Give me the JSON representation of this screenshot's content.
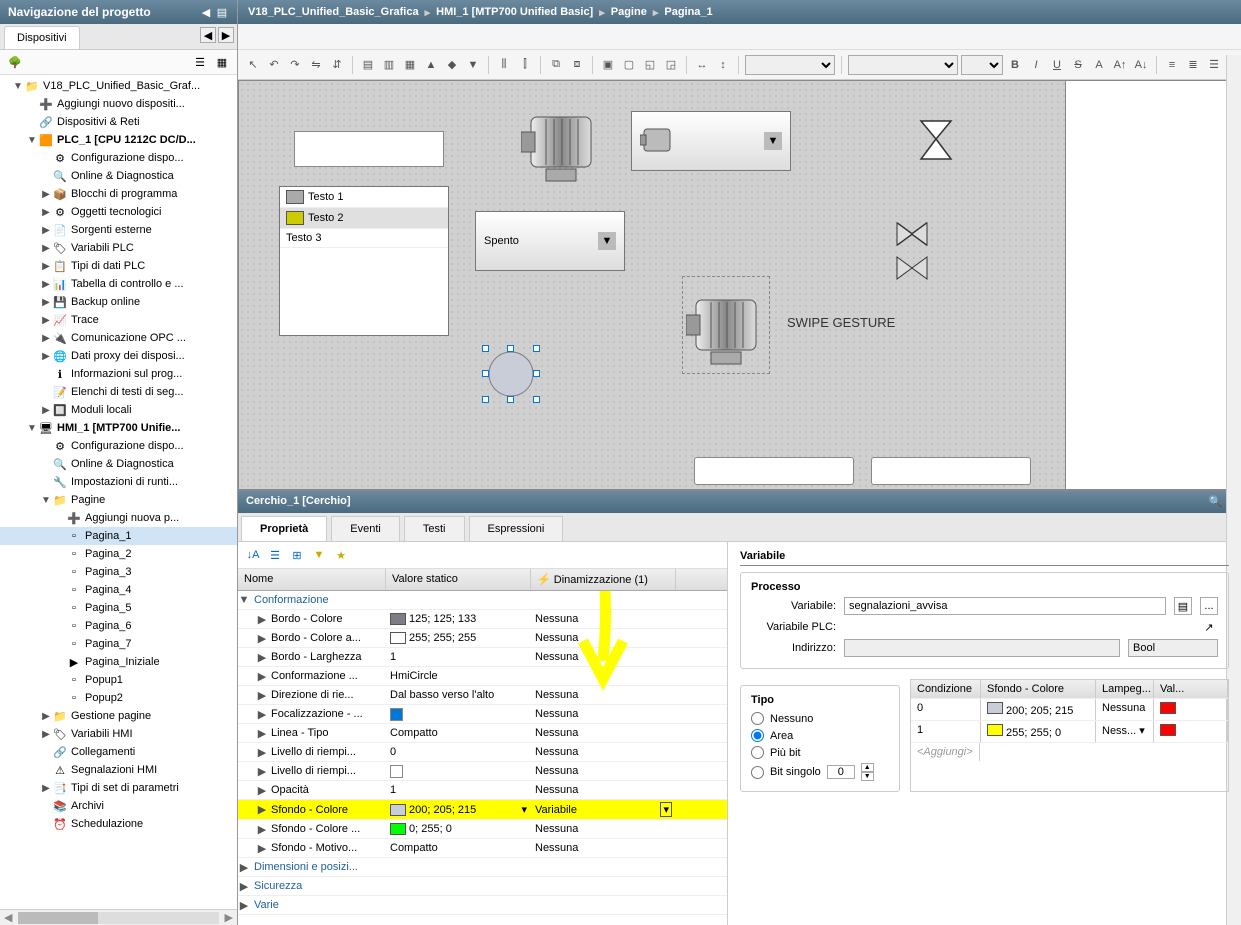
{
  "left": {
    "title": "Navigazione del progetto",
    "tab": "Dispositivi",
    "tree": [
      {
        "lvl": 0,
        "toggle": "▼",
        "icon": "📁",
        "label": "V18_PLC_Unified_Basic_Graf..."
      },
      {
        "lvl": 1,
        "toggle": "",
        "icon": "➕",
        "label": "Aggiungi nuovo dispositi..."
      },
      {
        "lvl": 1,
        "toggle": "",
        "icon": "🔗",
        "label": "Dispositivi & Reti"
      },
      {
        "lvl": 1,
        "toggle": "▼",
        "icon": "🟧",
        "label": "PLC_1 [CPU 1212C DC/D...",
        "bold": true
      },
      {
        "lvl": 2,
        "toggle": "",
        "icon": "⚙",
        "label": "Configurazione dispo..."
      },
      {
        "lvl": 2,
        "toggle": "",
        "icon": "🔍",
        "label": "Online & Diagnostica"
      },
      {
        "lvl": 2,
        "toggle": "▶",
        "icon": "📦",
        "label": "Blocchi di programma"
      },
      {
        "lvl": 2,
        "toggle": "▶",
        "icon": "⚙",
        "label": "Oggetti tecnologici"
      },
      {
        "lvl": 2,
        "toggle": "▶",
        "icon": "📄",
        "label": "Sorgenti esterne"
      },
      {
        "lvl": 2,
        "toggle": "▶",
        "icon": "🏷",
        "label": "Variabili PLC"
      },
      {
        "lvl": 2,
        "toggle": "▶",
        "icon": "📋",
        "label": "Tipi di dati PLC"
      },
      {
        "lvl": 2,
        "toggle": "▶",
        "icon": "📊",
        "label": "Tabella di controllo e ..."
      },
      {
        "lvl": 2,
        "toggle": "▶",
        "icon": "💾",
        "label": "Backup online"
      },
      {
        "lvl": 2,
        "toggle": "▶",
        "icon": "📈",
        "label": "Trace"
      },
      {
        "lvl": 2,
        "toggle": "▶",
        "icon": "🔌",
        "label": "Comunicazione OPC ..."
      },
      {
        "lvl": 2,
        "toggle": "▶",
        "icon": "🌐",
        "label": "Dati proxy dei disposi..."
      },
      {
        "lvl": 2,
        "toggle": "",
        "icon": "ℹ",
        "label": "Informazioni sul prog..."
      },
      {
        "lvl": 2,
        "toggle": "",
        "icon": "📝",
        "label": "Elenchi di testi di seg..."
      },
      {
        "lvl": 2,
        "toggle": "▶",
        "icon": "🔲",
        "label": "Moduli locali"
      },
      {
        "lvl": 1,
        "toggle": "▼",
        "icon": "🖥",
        "label": "HMI_1 [MTP700 Unifie...",
        "bold": true
      },
      {
        "lvl": 2,
        "toggle": "",
        "icon": "⚙",
        "label": "Configurazione dispo..."
      },
      {
        "lvl": 2,
        "toggle": "",
        "icon": "🔍",
        "label": "Online & Diagnostica"
      },
      {
        "lvl": 2,
        "toggle": "",
        "icon": "🔧",
        "label": "Impostazioni di runti..."
      },
      {
        "lvl": 2,
        "toggle": "▼",
        "icon": "📁",
        "label": "Pagine"
      },
      {
        "lvl": 3,
        "toggle": "",
        "icon": "➕",
        "label": "Aggiungi nuova p..."
      },
      {
        "lvl": 3,
        "toggle": "",
        "icon": "▫",
        "label": "Pagina_1",
        "selected": true
      },
      {
        "lvl": 3,
        "toggle": "",
        "icon": "▫",
        "label": "Pagina_2"
      },
      {
        "lvl": 3,
        "toggle": "",
        "icon": "▫",
        "label": "Pagina_3"
      },
      {
        "lvl": 3,
        "toggle": "",
        "icon": "▫",
        "label": "Pagina_4"
      },
      {
        "lvl": 3,
        "toggle": "",
        "icon": "▫",
        "label": "Pagina_5"
      },
      {
        "lvl": 3,
        "toggle": "",
        "icon": "▫",
        "label": "Pagina_6"
      },
      {
        "lvl": 3,
        "toggle": "",
        "icon": "▫",
        "label": "Pagina_7"
      },
      {
        "lvl": 3,
        "toggle": "",
        "icon": "▶",
        "label": "Pagina_Iniziale"
      },
      {
        "lvl": 3,
        "toggle": "",
        "icon": "▫",
        "label": "Popup1"
      },
      {
        "lvl": 3,
        "toggle": "",
        "icon": "▫",
        "label": "Popup2"
      },
      {
        "lvl": 2,
        "toggle": "▶",
        "icon": "📁",
        "label": "Gestione pagine"
      },
      {
        "lvl": 2,
        "toggle": "▶",
        "icon": "🏷",
        "label": "Variabili HMI"
      },
      {
        "lvl": 2,
        "toggle": "",
        "icon": "🔗",
        "label": "Collegamenti"
      },
      {
        "lvl": 2,
        "toggle": "",
        "icon": "⚠",
        "label": "Segnalazioni HMI"
      },
      {
        "lvl": 2,
        "toggle": "▶",
        "icon": "📑",
        "label": "Tipi di set di parametri"
      },
      {
        "lvl": 2,
        "toggle": "",
        "icon": "📚",
        "label": "Archivi"
      },
      {
        "lvl": 2,
        "toggle": "",
        "icon": "⏰",
        "label": "Schedulazione"
      }
    ]
  },
  "breadcrumb": [
    "V18_PLC_Unified_Basic_Grafica",
    "HMI_1 [MTP700 Unified Basic]",
    "Pagine",
    "Pagina_1"
  ],
  "canvas": {
    "list_items": [
      "Testo 1",
      "Testo 2",
      "Testo 3"
    ],
    "combo_value": "Spento",
    "swipe": "SWIPE GESTURE"
  },
  "props": {
    "header": "Cerchio_1 [Cerchio]",
    "search_label": "P",
    "tabs": [
      "Proprietà",
      "Eventi",
      "Testi",
      "Espressioni"
    ],
    "columns": [
      "Nome",
      "Valore statico",
      "Dinamizzazione (1)"
    ],
    "group": "Conformazione",
    "rows": [
      {
        "n": "Bordo - Colore",
        "v": "125; 125; 133",
        "c": "#7d7d85",
        "d": "Nessuna"
      },
      {
        "n": "Bordo - Colore a...",
        "v": "255; 255; 255",
        "c": "#ffffff",
        "d": "Nessuna"
      },
      {
        "n": "Bordo - Larghezza",
        "v": "1",
        "d": "Nessuna"
      },
      {
        "n": "Conformazione ...",
        "v": "HmiCircle",
        "d": ""
      },
      {
        "n": "Direzione di rie...",
        "v": "Dal basso verso l'alto",
        "d": "Nessuna"
      },
      {
        "n": "Focalizzazione - ...",
        "v": "",
        "chk": true,
        "d": "Nessuna"
      },
      {
        "n": "Linea - Tipo",
        "v": "Compatto",
        "d": "Nessuna"
      },
      {
        "n": "Livello di riempi...",
        "v": "0",
        "d": "Nessuna"
      },
      {
        "n": "Livello di riempi...",
        "v": "",
        "chk": false,
        "d": "Nessuna"
      },
      {
        "n": "Opacità",
        "v": "1",
        "d": "Nessuna"
      },
      {
        "n": "Sfondo - Colore",
        "v": "200; 205; 215",
        "c": "#c8cdd7",
        "d": "Variabile",
        "hl": true,
        "dd": true
      },
      {
        "n": "Sfondo - Colore ...",
        "v": "0; 255; 0",
        "c": "#00ff00",
        "d": "Nessuna"
      },
      {
        "n": "Sfondo - Motivo...",
        "v": "Compatto",
        "d": "Nessuna"
      }
    ],
    "groups_after": [
      "Dimensioni e posizi...",
      "Sicurezza",
      "Varie"
    ]
  },
  "right": {
    "var_label": "Variabile",
    "proc_title": "Processo",
    "var_field": "Variabile:",
    "var_value": "segnalazioni_avvisa",
    "varplc_field": "Variabile PLC:",
    "addr_field": "Indirizzo:",
    "addr_type": "Bool",
    "tipo_title": "Tipo",
    "radios": [
      "Nessuno",
      "Area",
      "Più bit",
      "Bit singolo"
    ],
    "bit_value": "0",
    "table_cols": [
      "Condizione",
      "Sfondo - Colore",
      "Lampeg...",
      "Val..."
    ],
    "table_rows": [
      {
        "cond": "0",
        "col": "200; 205; 215",
        "cc": "#c8cdd7",
        "lamp": "Nessuna",
        "val": "",
        "vc": "#ff0000"
      },
      {
        "cond": "1",
        "col": "255; 255; 0",
        "cc": "#ffff00",
        "lamp": "Ness...",
        "val": "",
        "vc": "#ff0000",
        "dd": true
      }
    ],
    "add_row": "<Aggiungi>"
  }
}
